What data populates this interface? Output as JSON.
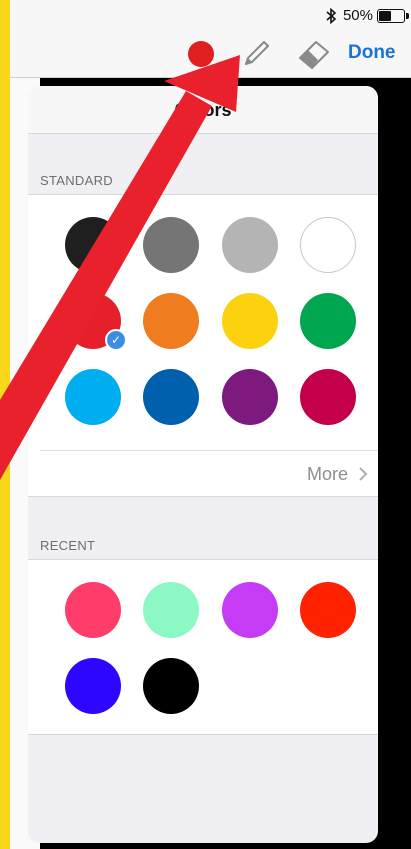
{
  "status_bar": {
    "battery_text": "50%"
  },
  "toolbar": {
    "selected_color": "#e02020",
    "done_label": "Done"
  },
  "popover": {
    "title": "Colors",
    "standard_label": "STANDARD",
    "standard_colors": [
      "#1f1f1f",
      "#757575",
      "#b4b4b4",
      "#ffffff",
      "#e5202a",
      "#ef7d1f",
      "#fcd20f",
      "#00a650",
      "#00aeef",
      "#0060ae",
      "#7e1a7e",
      "#c5004b"
    ],
    "selected_index": 4,
    "more_label": "More",
    "recent_label": "RECENT",
    "recent_colors": [
      "#ff3d6b",
      "#8cf8c4",
      "#c63cf5",
      "#ff2303",
      "#2d06ff",
      "#000000"
    ]
  },
  "annotation": {
    "arrow_color": "#e8212c"
  }
}
